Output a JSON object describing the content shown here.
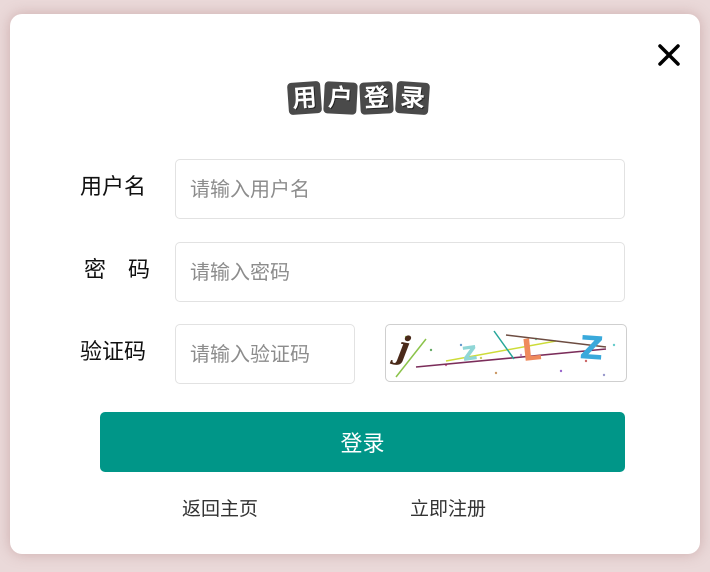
{
  "dialog": {
    "title": "用户登录",
    "title_chars": [
      "用",
      "户",
      "登",
      "录"
    ]
  },
  "form": {
    "username": {
      "label": "用户名",
      "placeholder": "请输入用户名",
      "value": ""
    },
    "password": {
      "label": "密　码",
      "placeholder": "请输入密码",
      "value": ""
    },
    "captcha": {
      "label": "验证码",
      "placeholder": "请输入验证码",
      "value": "",
      "image_chars": [
        "j",
        "z",
        "L",
        "Z"
      ]
    },
    "login_label": "登录"
  },
  "links": {
    "home": "返回主页",
    "register": "立即注册"
  },
  "icons": {
    "close": "close-icon"
  },
  "colors": {
    "primary": "#009688",
    "backdrop": "#ead9d9",
    "title_tile": "#4a4a4a"
  }
}
